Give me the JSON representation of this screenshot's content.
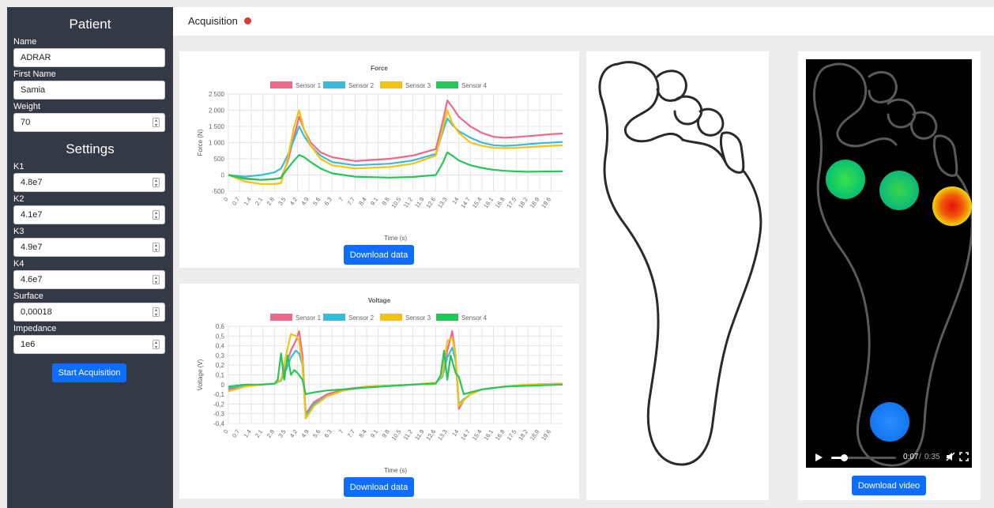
{
  "sidebar": {
    "patient_title": "Patient",
    "settings_title": "Settings",
    "patient_fields": [
      {
        "label": "Name",
        "value": "ADRAR",
        "spinner": false
      },
      {
        "label": "First Name",
        "value": "Samia",
        "spinner": false
      },
      {
        "label": "Weight",
        "value": "70",
        "spinner": true
      }
    ],
    "settings_fields": [
      {
        "label": "K1",
        "value": "4.8e7"
      },
      {
        "label": "K2",
        "value": "4.1e7"
      },
      {
        "label": "K3",
        "value": "4.9e7"
      },
      {
        "label": "K4",
        "value": "4.6e7"
      },
      {
        "label": "Surface",
        "value": "0,00018"
      },
      {
        "label": "Impedance",
        "value": "1e6"
      }
    ],
    "start_button": "Start Acquisition"
  },
  "header": {
    "title": "Acquisition",
    "status_color": "#d63c3c"
  },
  "colors": {
    "sensor1": "#ee6a8a",
    "sensor2": "#3bbbdb",
    "sensor3": "#f4c30f",
    "sensor4": "#27c658",
    "button": "#0d6efd",
    "sidebar": "#343a45"
  },
  "force_panel": {
    "download_label": "Download data"
  },
  "voltage_panel": {
    "download_label": "Download data"
  },
  "video_panel": {
    "time_current": "0:07",
    "time_total": "0:35",
    "progress": 0.2,
    "download_label": "Download video"
  },
  "chart_data": [
    {
      "type": "line",
      "title": "Force",
      "xlabel": "Time (s)",
      "ylabel": "Force (N)",
      "ylim": [
        -500,
        2500
      ],
      "yticks": [
        "2 500",
        "2 000",
        "1 500",
        "1 000",
        "500",
        "0",
        "-500"
      ],
      "ytick_values": [
        2500,
        2000,
        1500,
        1000,
        500,
        0,
        -500
      ],
      "x_ticks": [
        "0",
        "0.7",
        "1.4",
        "2.1",
        "2.8",
        "3.5",
        "4.2",
        "4.9",
        "5.6",
        "6.3",
        "7",
        "7.7",
        "8.4",
        "9.1",
        "9.8",
        "10.5",
        "11.2",
        "11.9",
        "12.6",
        "13.3",
        "14",
        "14.7",
        "15.4",
        "16.1",
        "16.8",
        "17.5",
        "18.2",
        "18.9",
        "19.6"
      ],
      "legend_position": "top",
      "grid": true,
      "series": [
        {
          "name": "Sensor 1",
          "color": "#ee6a8a",
          "x": [
            0,
            1,
            2,
            2.8,
            3.2,
            3.6,
            4.0,
            4.3,
            4.6,
            5.0,
            5.6,
            6.3,
            7.7,
            9.8,
            11.2,
            12.6,
            13.0,
            13.3,
            13.6,
            14.0,
            14.7,
            15.4,
            16.1,
            16.8,
            17.5,
            18.2,
            18.9,
            19.6,
            20.3
          ],
          "y": [
            0,
            -100,
            -150,
            -120,
            -100,
            400,
            1200,
            1800,
            1400,
            1000,
            700,
            550,
            430,
            500,
            600,
            800,
            1600,
            2300,
            2100,
            1800,
            1500,
            1300,
            1180,
            1150,
            1170,
            1200,
            1230,
            1260,
            1280
          ]
        },
        {
          "name": "Sensor 2",
          "color": "#3bbbdb",
          "x": [
            0,
            1,
            2,
            2.8,
            3.2,
            3.6,
            4.0,
            4.3,
            4.6,
            5.0,
            5.6,
            6.3,
            7.7,
            9.8,
            11.2,
            12.6,
            13.0,
            13.3,
            13.6,
            14.0,
            14.7,
            15.4,
            16.1,
            16.8,
            17.5,
            18.2,
            18.9,
            19.6,
            20.3
          ],
          "y": [
            0,
            -50,
            0,
            80,
            200,
            600,
            1100,
            1500,
            1200,
            900,
            600,
            400,
            300,
            350,
            450,
            650,
            1300,
            1750,
            1550,
            1350,
            1150,
            1000,
            920,
            900,
            920,
            950,
            980,
            1000,
            1020
          ]
        },
        {
          "name": "Sensor 3",
          "color": "#f4c30f",
          "x": [
            0,
            1,
            2,
            2.8,
            3.2,
            3.6,
            4.0,
            4.3,
            4.6,
            5.0,
            5.6,
            6.3,
            7.7,
            9.8,
            11.2,
            12.6,
            13.0,
            13.3,
            13.6,
            14.0,
            14.7,
            15.4,
            16.1,
            16.8,
            17.5,
            18.2,
            18.9,
            19.6,
            20.3
          ],
          "y": [
            0,
            -200,
            -280,
            -280,
            -250,
            500,
            1500,
            2000,
            1400,
            900,
            500,
            300,
            200,
            250,
            350,
            600,
            1400,
            2000,
            1600,
            1300,
            1000,
            900,
            840,
            830,
            840,
            860,
            880,
            900,
            920
          ]
        },
        {
          "name": "Sensor 4",
          "color": "#27c658",
          "x": [
            0,
            1,
            2,
            2.8,
            3.2,
            3.6,
            4.0,
            4.3,
            4.6,
            5.0,
            5.6,
            6.3,
            7.7,
            9.8,
            11.2,
            12.6,
            13.0,
            13.3,
            13.6,
            14.0,
            14.7,
            15.4,
            16.1,
            16.8,
            17.5,
            18.2,
            18.9,
            19.6,
            20.3
          ],
          "y": [
            0,
            -120,
            -150,
            -130,
            -80,
            200,
            450,
            620,
            550,
            400,
            200,
            50,
            -50,
            -80,
            -60,
            0,
            350,
            700,
            600,
            450,
            300,
            220,
            160,
            130,
            110,
            100,
            105,
            110,
            115
          ]
        }
      ]
    },
    {
      "type": "line",
      "title": "Voltage",
      "xlabel": "Time (s)",
      "ylabel": "Voltage (V)",
      "ylim": [
        -0.4,
        0.6
      ],
      "yticks": [
        "0,6",
        "0,5",
        "0,4",
        "0,3",
        "0,2",
        "0,1",
        "0",
        "-0,1",
        "-0,2",
        "-0,3",
        "-0,4"
      ],
      "ytick_values": [
        0.6,
        0.5,
        0.4,
        0.3,
        0.2,
        0.1,
        0,
        -0.1,
        -0.2,
        -0.3,
        -0.4
      ],
      "x_ticks": [
        "0",
        "0.7",
        "1.4",
        "2.1",
        "2.8",
        "3.5",
        "4.2",
        "4.9",
        "5.6",
        "6.3",
        "7",
        "7.7",
        "8.4",
        "9.1",
        "9.8",
        "10.5",
        "11.2",
        "11.9",
        "12.6",
        "13.3",
        "14",
        "14.7",
        "15.4",
        "16.1",
        "16.8",
        "17.5",
        "18.2",
        "18.9",
        "19.6"
      ],
      "legend_position": "top",
      "grid": true,
      "series": [
        {
          "name": "Sensor 1",
          "color": "#ee6a8a",
          "x": [
            0,
            1,
            2,
            2.8,
            3.2,
            3.5,
            3.8,
            4.1,
            4.3,
            4.5,
            4.7,
            5.2,
            6.0,
            7.0,
            8.4,
            11.2,
            12.6,
            13.0,
            13.3,
            13.6,
            13.8,
            14.0,
            14.3,
            14.7,
            15.4,
            16.8,
            18.2,
            20.3
          ],
          "y": [
            -0.05,
            -0.01,
            0.0,
            0.01,
            0.05,
            0.2,
            0.35,
            0.45,
            0.55,
            0.3,
            -0.3,
            -0.18,
            -0.1,
            -0.05,
            -0.02,
            0.0,
            0.02,
            0.1,
            0.35,
            0.55,
            0.3,
            -0.25,
            -0.16,
            -0.1,
            -0.05,
            -0.02,
            0.0,
            0.01
          ]
        },
        {
          "name": "Sensor 2",
          "color": "#3bbbdb",
          "x": [
            0,
            1,
            2,
            2.8,
            3.2,
            3.5,
            3.8,
            4.1,
            4.3,
            4.5,
            4.7,
            5.2,
            6.0,
            7.0,
            8.4,
            11.2,
            12.6,
            13.0,
            13.3,
            13.6,
            13.8,
            14.0,
            14.3,
            14.7,
            15.4,
            16.8,
            18.2,
            20.3
          ],
          "y": [
            -0.03,
            -0.01,
            0.0,
            0.01,
            0.04,
            0.15,
            0.28,
            0.35,
            0.32,
            0.2,
            -0.32,
            -0.2,
            -0.12,
            -0.06,
            -0.02,
            0.0,
            0.02,
            0.08,
            0.28,
            0.38,
            0.25,
            -0.2,
            -0.15,
            -0.1,
            -0.05,
            -0.02,
            0.0,
            0.01
          ]
        },
        {
          "name": "Sensor 3",
          "color": "#f4c30f",
          "x": [
            0,
            1,
            2,
            2.8,
            3.2,
            3.5,
            3.8,
            4.1,
            4.3,
            4.5,
            4.7,
            5.2,
            6.0,
            7.0,
            8.4,
            11.2,
            12.6,
            13.0,
            13.3,
            13.6,
            13.8,
            14.0,
            14.3,
            14.7,
            15.4,
            16.8,
            18.2,
            20.3
          ],
          "y": [
            -0.07,
            -0.02,
            0.0,
            0.01,
            0.05,
            0.3,
            0.52,
            0.5,
            0.45,
            0.2,
            -0.35,
            -0.22,
            -0.12,
            -0.06,
            -0.02,
            0.0,
            0.02,
            0.1,
            0.45,
            0.48,
            0.3,
            -0.22,
            -0.16,
            -0.1,
            -0.05,
            -0.02,
            0.0,
            0.01
          ]
        },
        {
          "name": "Sensor 4",
          "color": "#27c658",
          "x": [
            0,
            1,
            2,
            2.8,
            3.0,
            3.2,
            3.4,
            3.6,
            3.8,
            4.0,
            4.2,
            4.5,
            4.7,
            5.2,
            6.0,
            7.0,
            8.4,
            11.2,
            12.6,
            12.9,
            13.1,
            13.3,
            13.5,
            13.8,
            14.0,
            14.3,
            14.7,
            15.4,
            16.8,
            20.3
          ],
          "y": [
            -0.02,
            0.0,
            0.0,
            0.01,
            0.05,
            0.32,
            0.05,
            0.3,
            0.1,
            0.15,
            0.12,
            0.05,
            -0.1,
            -0.08,
            -0.06,
            -0.05,
            -0.03,
            0.0,
            0.01,
            0.1,
            0.35,
            0.05,
            0.3,
            0.12,
            0.08,
            -0.1,
            -0.08,
            -0.05,
            -0.02,
            0.0
          ]
        }
      ]
    }
  ]
}
